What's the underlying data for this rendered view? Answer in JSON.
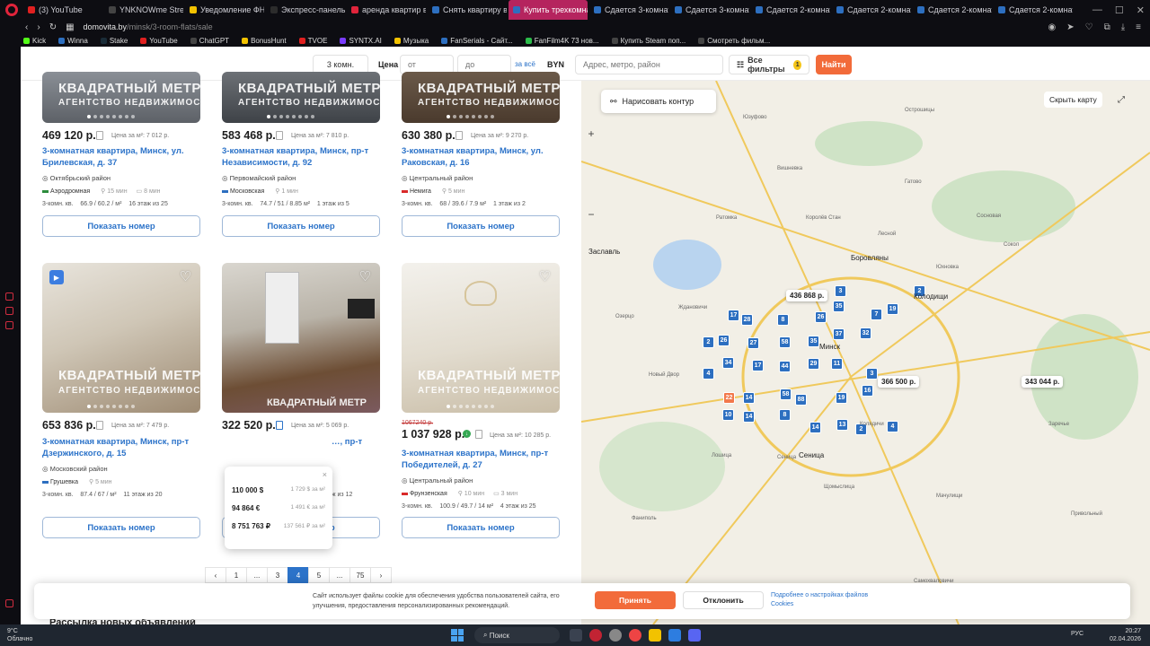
{
  "browser": {
    "tabs": [
      {
        "label": "(3) YouTube",
        "color": "#e02020"
      },
      {
        "label": "YNKNOWme Stream -",
        "color": "#444"
      },
      {
        "label": "Уведомление ФНС о",
        "color": "#f2c200"
      },
      {
        "label": "Экспресс-панель",
        "color": "#2c2c2c"
      },
      {
        "label": "аренда квартир в мин",
        "color": "#e0243b"
      },
      {
        "label": "Снять квартиру в Мин",
        "color": "#2d6fc0"
      },
      {
        "label": "Купить трехкомнатную",
        "color": "#2d6fc0"
      },
      {
        "label": "Сдается 3-комнатная",
        "color": "#2d6fc0"
      },
      {
        "label": "Сдается 3-комнатная",
        "color": "#2d6fc0"
      },
      {
        "label": "Сдается 2-комнатная",
        "color": "#2d6fc0"
      },
      {
        "label": "Сдается 2-комнатная",
        "color": "#2d6fc0"
      },
      {
        "label": "Сдается 2-комнатная",
        "color": "#2d6fc0"
      },
      {
        "label": "Сдается 2-комнатная",
        "color": "#2d6fc0"
      }
    ],
    "url_host": "domovita.by",
    "url_path": "/minsk/3-room-flats/sale",
    "bookmarks": [
      {
        "label": "Kick",
        "color": "#53fc18"
      },
      {
        "label": "Winna",
        "color": "#2d6fc0"
      },
      {
        "label": "Stake",
        "color": "#1a2c38"
      },
      {
        "label": "YouTube",
        "color": "#e02020"
      },
      {
        "label": "ChatGPT",
        "color": "#444"
      },
      {
        "label": "BonusHunt",
        "color": "#f2c200"
      },
      {
        "label": "TVOE",
        "color": "#e02020"
      },
      {
        "label": "SYNTX.AI",
        "color": "#7a3cff"
      },
      {
        "label": "Музыка",
        "color": "#f2c200"
      },
      {
        "label": "FanSerials - Сайт...",
        "color": "#2d6fc0"
      },
      {
        "label": "FanFilm4K 73 нов...",
        "color": "#2cbc4a"
      },
      {
        "label": "Купить Steam поп...",
        "color": "#444"
      },
      {
        "label": "Смотреть фильм...",
        "color": "#444"
      }
    ]
  },
  "search": {
    "rooms": "3 комн.",
    "price_label": "Цена",
    "from_placeholder": "от",
    "to_placeholder": "до",
    "per_all": "за всё",
    "currency": "BYN",
    "address_placeholder": "Адрес, метро, район",
    "filters_label": "Все фильтры",
    "filters_count": "1",
    "find_label": "Найти"
  },
  "listings": [
    {
      "price": "469 120 р.",
      "price_per_m": "Цена за м²: 7 012 р.",
      "title": "3-комнатная квартира, Минск, ул. Брилевская, д. 37",
      "district": "Октябрьский район",
      "metro": "Аэродромная",
      "metro_color": "#2d8c3c",
      "walk": "15 мин",
      "transport": "8 мин",
      "type": "3-комн. кв.",
      "area": "66.9 / 60.2 / м²",
      "floor": "16 этаж из 25",
      "btn": "Показать номер"
    },
    {
      "price": "583 468 р.",
      "price_per_m": "Цена за м²: 7 810 р.",
      "title": "3-комнатная квартира, Минск, пр-т Независимости, д. 92",
      "district": "Первомайский район",
      "metro": "Московская",
      "metro_color": "#2d6fc0",
      "walk": "1 мин",
      "transport": "",
      "type": "3-комн. кв.",
      "area": "74.7 / 51 / 8.85 м²",
      "floor": "1 этаж из 5",
      "btn": "Показать номер"
    },
    {
      "price": "630 380 р.",
      "price_per_m": "Цена за м²: 9 270 р.",
      "title": "3-комнатная квартира, Минск, ул. Раковская, д. 16",
      "district": "Центральный район",
      "metro": "Немига",
      "metro_color": "#d92a2a",
      "walk": "5 мин",
      "transport": "",
      "type": "3-комн. кв.",
      "area": "68 / 39.6 / 7.9 м²",
      "floor": "1 этаж из 2",
      "btn": "Показать номер"
    },
    {
      "price": "653 836 р.",
      "price_per_m": "Цена за м²: 7 479 р.",
      "title": "3-комнатная квартира, Минск, пр-т Дзержинского, д. 15",
      "district": "Московский район",
      "metro": "Грушевка",
      "metro_color": "#2d6fc0",
      "walk": "5 мин",
      "transport": "",
      "type": "3-комн. кв.",
      "area": "87.4 / 67 / м²",
      "floor": "11 этаж из 20",
      "btn": "Показать номер"
    },
    {
      "price": "322 520 р.",
      "price_per_m": "Цена за м²: 5 069 р.",
      "title": "3-комнатная квартира, Минск, пр-т",
      "district": "",
      "metro": "",
      "metro_color": "#2d6fc0",
      "walk": "",
      "transport": "",
      "type": "",
      "area": "",
      "floor": "аж из 12",
      "btn": "Показать номер"
    },
    {
      "old_price": "1067240 р.",
      "price": "1 037 928 р.",
      "price_per_m": "Цена за м²: 10 285 р.",
      "title": "3-комнатная квартира, Минск, пр-т Победителей, д. 27",
      "district": "Центральный район",
      "metro": "Фрунзенская",
      "metro_color": "#d92a2a",
      "walk": "10 мин",
      "transport": "3 мин",
      "type": "3-комн. кв.",
      "area": "100.9 / 49.7 / 14 м²",
      "floor": "4 этаж из 25",
      "btn": "Показать номер"
    }
  ],
  "watermark": {
    "line1": "КВАДРАТНЫЙ МЕТР",
    "line2": "АГЕНТСТВО НЕДВИЖИМОСТИ"
  },
  "currency_popup": [
    {
      "amount": "110 000 $",
      "per_m": "1 729 $ за м²"
    },
    {
      "amount": "94 864 €",
      "per_m": "1 491 € за м²"
    },
    {
      "amount": "8 751 763 ₽",
      "per_m": "137 561 ₽ за м²"
    }
  ],
  "pager": [
    "‹",
    "1",
    "...",
    "3",
    "4",
    "5",
    "...",
    "75",
    "›"
  ],
  "pager_active": "4",
  "map": {
    "draw_label": "Нарисовать контур",
    "hide_label": "Скрыть карту",
    "prices": [
      "436 868 р.",
      "366 500 р.",
      "343 044 р."
    ],
    "towns": [
      "Заславль",
      "Боровляны",
      "Колодищи",
      "Минск",
      "Сеница"
    ],
    "places": [
      "Острошицы",
      "Юзуфово",
      "Вишневка",
      "Ждановичи",
      "Сеница",
      "Колядичи",
      "Фаниполь",
      "Сосновая",
      "Лесной",
      "Сокол",
      "Юхновка",
      "Гатово",
      "Озерцо",
      "Мачулищи",
      "Щомыслица",
      "Ратомка",
      "Новый Двор",
      "Лошица",
      "Королёв Стан",
      "Привольный",
      "Заречье",
      "Самохваловичи"
    ],
    "badges": [
      "3",
      "2",
      "17",
      "28",
      "8",
      "26",
      "35",
      "7",
      "19",
      "2",
      "26",
      "27",
      "58",
      "35",
      "37",
      "32",
      "4",
      "34",
      "17",
      "44",
      "29",
      "11",
      "3",
      "22",
      "14",
      "58",
      "88",
      "19",
      "16",
      "10",
      "14",
      "8",
      "14",
      "13",
      "2",
      "4"
    ]
  },
  "cookie": {
    "text": "Сайт использует файлы cookie для обеспечения удобства пользователей сайта, его улучшения, предоставления персонализированных рекомендаций.",
    "accept": "Принять",
    "decline": "Отклонить",
    "more": "Подробнее о настройках файлов Cookies"
  },
  "newsletter": "Рассылка новых объявлений",
  "taskbar": {
    "weather_temp": "9°C",
    "weather_desc": "Облачно",
    "search": "Поиск",
    "lang": "РУС",
    "time": "20:27",
    "date": "02.04.2026"
  }
}
